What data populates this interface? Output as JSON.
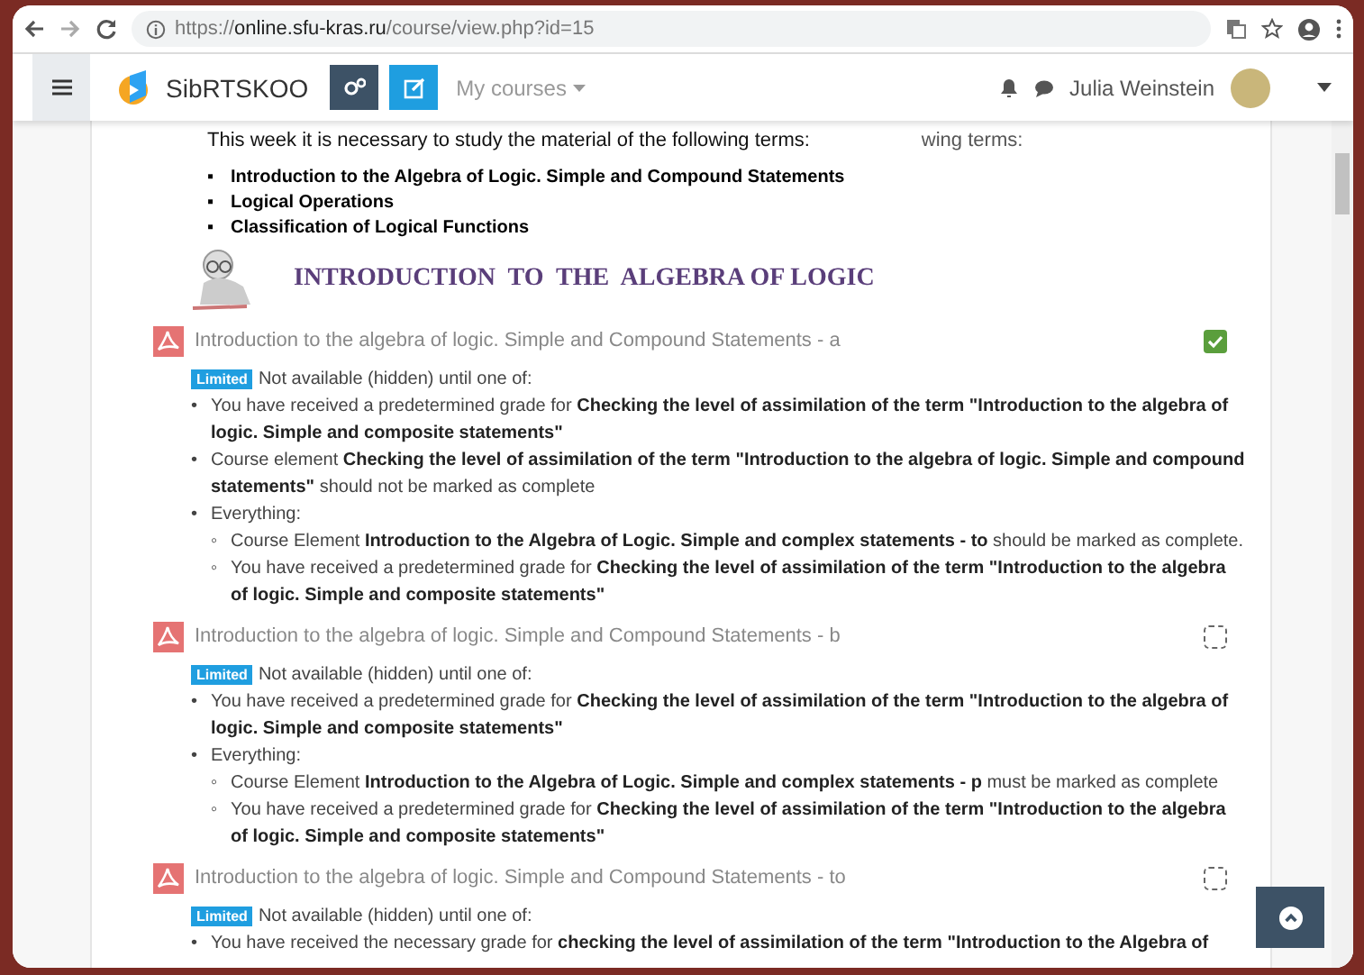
{
  "browser": {
    "url_parts": [
      {
        "text": "https://",
        "emphasis": false
      },
      {
        "text": "online.sfu-kras.ru",
        "emphasis": true
      },
      {
        "text": "/course/view.php?id=15",
        "emphasis": false
      }
    ]
  },
  "navbar": {
    "site_name": "SibRTSKOO",
    "menu": "My courses",
    "user_name": "Julia Weinstein"
  },
  "intro": {
    "text": "This week it is necessary to study the material of the following terms:",
    "ghost_text": "wing terms:",
    "terms": [
      {
        "marker": "▪",
        "text": "Introduction to the Algebra of Logic. Simple and Compound Statements"
      },
      {
        "marker": "▪",
        "text": "Logical Operations"
      },
      {
        "marker": "▪",
        "text": "Classification of Logical Functions"
      }
    ],
    "banner_title": "INTRODUCTION  TO  THE  ALGEBRA OF LOGIC"
  },
  "activities": [
    {
      "title": "Introduction to the algebra of logic. Simple and Compound Statements - a",
      "completed": true,
      "restriction": {
        "badge": "Limited",
        "text": "Not available (hidden) until one of:",
        "conditions": [
          {
            "marker": "•",
            "text": "You have received a predetermined grade for **Checking the level of assimilation of the term \"Introduction to the algebra of logic. Simple and composite statements\"**"
          },
          {
            "marker": "•",
            "text": "Course element **Checking the level of assimilation of the term \"Introduction to the algebra of logic. Simple and compound statements\"** should not be marked as complete"
          },
          {
            "marker": "•",
            "text": "Everything:",
            "children": [
              {
                "marker": "◦",
                "text": "Course Element **Introduction to the Algebra of Logic. Simple and complex statements - to** should be marked as complete."
              },
              {
                "marker": "◦",
                "text": "You have received a predetermined grade for **Checking the level of assimilation of the term \"Introduction to the algebra of logic. Simple and composite statements\"**"
              }
            ]
          }
        ]
      }
    },
    {
      "title": "Introduction to the algebra of logic. Simple and Compound Statements - b",
      "completed": false,
      "restriction": {
        "badge": "Limited",
        "text": "Not available (hidden) until one of:",
        "conditions": [
          {
            "marker": "•",
            "text": "You have received a predetermined grade for **Checking the level of assimilation of the term \"Introduction to the algebra of logic. Simple and composite statements\"**"
          },
          {
            "marker": "•",
            "text": "Everything:",
            "children": [
              {
                "marker": "◦",
                "text": "Course Element **Introduction to the Algebra of Logic. Simple and complex statements - p** must be marked as complete"
              },
              {
                "marker": "◦",
                "text": "You have received a predetermined grade for **Checking the level of assimilation of the term \"Introduction to the algebra of logic. Simple and composite statements\"**"
              }
            ]
          }
        ]
      }
    },
    {
      "title": "Introduction to the algebra of logic. Simple and Compound Statements - to",
      "completed": false,
      "restriction": {
        "badge": "Limited",
        "text": "Not available (hidden) until one of:",
        "conditions": [
          {
            "marker": "•",
            "text": "You have received the necessary grade for **checking the level of assimilation of the term \"Introduction to the Algebra of**"
          }
        ]
      }
    }
  ]
}
